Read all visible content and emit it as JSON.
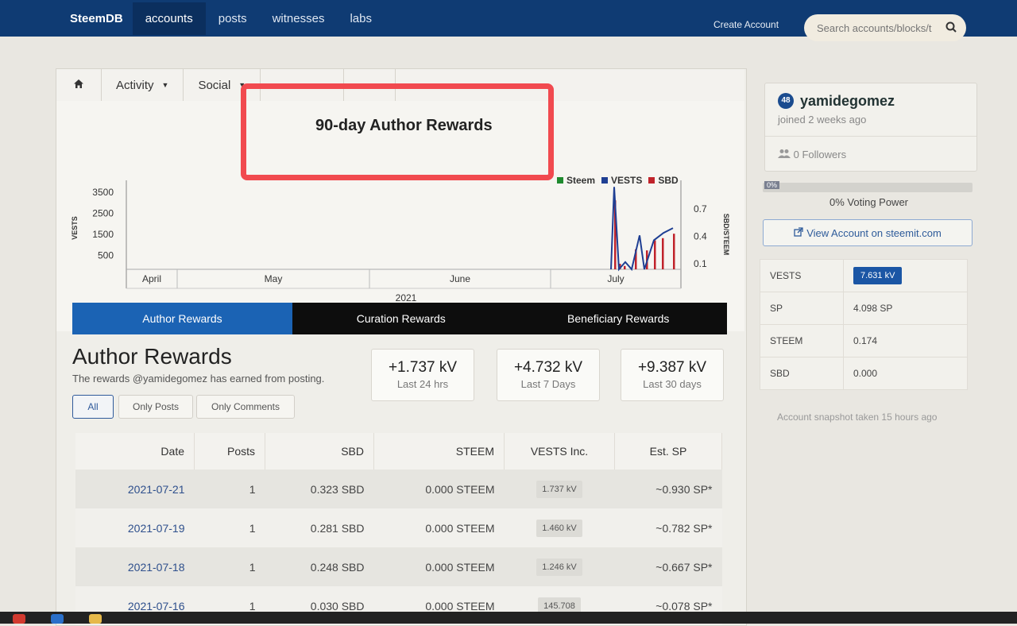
{
  "nav": {
    "brand": "SteemDB",
    "links": [
      "accounts",
      "posts",
      "witnesses",
      "labs"
    ],
    "create_account": "Create Account",
    "search_placeholder": "Search accounts/blocks/t"
  },
  "subnav": {
    "tabs": [
      "Activity",
      "Social"
    ]
  },
  "chart_data": {
    "type": "bar",
    "title": "90-day Author Rewards",
    "legend": [
      "Steem",
      "VESTS",
      "SBD"
    ],
    "legend_colors": [
      "#1e8a2e",
      "#1f3f93",
      "#c0232b"
    ],
    "ylabel_left": "VESTS",
    "ylabel_right": "SBD/STEEM",
    "y_ticks_left": [
      "3500",
      "2500",
      "1500",
      "500"
    ],
    "y_ticks_right": [
      "0.7",
      "0.4",
      "0.1"
    ],
    "x_months": [
      "April",
      "May",
      "June",
      "July"
    ],
    "x_year": "2021",
    "series": [
      {
        "name": "VESTS",
        "kind": "line",
        "values": [
          0,
          3400,
          0,
          300,
          0,
          1400,
          0,
          1200,
          1500,
          1700
        ]
      },
      {
        "name": "SBD",
        "kind": "bar",
        "values": [
          0.62,
          0.05,
          0.03,
          0.18,
          0.17,
          0.26,
          0.28,
          0.32
        ]
      }
    ]
  },
  "tabs": [
    "Author Rewards",
    "Curation Rewards",
    "Beneficiary Rewards"
  ],
  "section": {
    "title": "Author Rewards",
    "subtitle": "The rewards @yamidegomez has earned from posting."
  },
  "stats": [
    {
      "value": "+1.737 kV",
      "label": "Last 24 hrs"
    },
    {
      "value": "+4.732 kV",
      "label": "Last 7 Days"
    },
    {
      "value": "+9.387 kV",
      "label": "Last 30 days"
    }
  ],
  "filters": [
    "All",
    "Only Posts",
    "Only Comments"
  ],
  "table": {
    "headers": [
      "Date",
      "Posts",
      "SBD",
      "STEEM",
      "VESTS Inc.",
      "Est. SP"
    ],
    "rows": [
      {
        "date": "2021-07-21",
        "posts": "1",
        "sbd": "0.323 SBD",
        "steem": "0.000 STEEM",
        "vests": "1.737 kV",
        "sp": "~0.930 SP*"
      },
      {
        "date": "2021-07-19",
        "posts": "1",
        "sbd": "0.281 SBD",
        "steem": "0.000 STEEM",
        "vests": "1.460 kV",
        "sp": "~0.782 SP*"
      },
      {
        "date": "2021-07-18",
        "posts": "1",
        "sbd": "0.248 SBD",
        "steem": "0.000 STEEM",
        "vests": "1.246 kV",
        "sp": "~0.667 SP*"
      },
      {
        "date": "2021-07-16",
        "posts": "1",
        "sbd": "0.030 SBD",
        "steem": "0.000 STEEM",
        "vests": "145.708",
        "sp": "~0.078 SP*"
      }
    ]
  },
  "profile": {
    "reputation": "48",
    "username": "yamidegomez",
    "joined": "joined 2 weeks ago",
    "followers": "0 Followers",
    "voting_power_tag": "0%",
    "voting_power_label": "0% Voting Power",
    "voting_power_fraction": 0,
    "steemit_link": "View Account on steemit.com"
  },
  "balances": [
    {
      "key": "VESTS",
      "value": "7.631 kV",
      "highlight": true
    },
    {
      "key": "SP",
      "value": "4.098 SP"
    },
    {
      "key": "STEEM",
      "value": "0.174"
    },
    {
      "key": "SBD",
      "value": "0.000"
    }
  ],
  "snapshot": "Account snapshot taken 15 hours ago"
}
